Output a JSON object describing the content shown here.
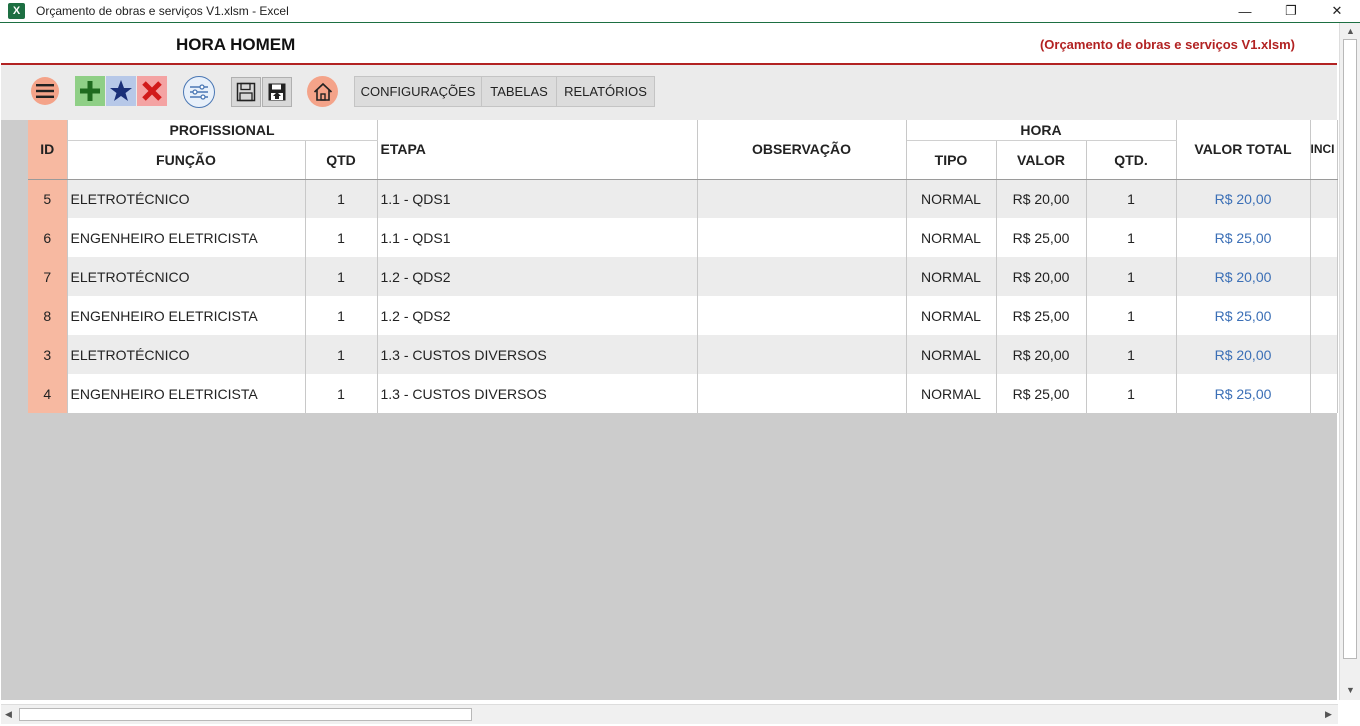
{
  "window": {
    "title": "Orçamento de obras e serviços V1.xlsm - Excel",
    "app_icon": "X",
    "minimize": "—",
    "restore": "❐",
    "close": "✕"
  },
  "header": {
    "page_title": "HORA HOMEM",
    "file_name": "(Orçamento de obras e serviços V1.xlsm)"
  },
  "toolbar": {
    "icons": [
      "menu-icon",
      "add-icon",
      "star-icon",
      "delete-icon",
      "filter-settings-icon",
      "save-icon",
      "save-as-icon",
      "home-icon"
    ],
    "menus": [
      "CONFIGURAÇÕES",
      "TABELAS",
      "RELATÓRIOS"
    ]
  },
  "table": {
    "group_headers": {
      "profissional": "PROFISSIONAL",
      "hora": "HORA"
    },
    "headers": {
      "id": "ID",
      "funcao": "FUNÇÃO",
      "qtd": "QTD",
      "etapa": "ETAPA",
      "observacao": "OBSERVAÇÃO",
      "tipo": "TIPO",
      "valor": "VALOR",
      "qtd_hora": "QTD.",
      "valor_total": "VALOR TOTAL",
      "clipped": "INCI"
    },
    "rows": [
      {
        "id": "5",
        "funcao": "ELETROTÉCNICO",
        "qtd": "1",
        "etapa": "1.1 - QDS1",
        "observacao": "",
        "tipo": "NORMAL",
        "valor": "R$ 20,00",
        "qtd_hora": "1",
        "valor_total": "R$ 20,00"
      },
      {
        "id": "6",
        "funcao": "ENGENHEIRO ELETRICISTA",
        "qtd": "1",
        "etapa": "1.1 - QDS1",
        "observacao": "",
        "tipo": "NORMAL",
        "valor": "R$ 25,00",
        "qtd_hora": "1",
        "valor_total": "R$ 25,00"
      },
      {
        "id": "7",
        "funcao": "ELETROTÉCNICO",
        "qtd": "1",
        "etapa": "1.2 - QDS2",
        "observacao": "",
        "tipo": "NORMAL",
        "valor": "R$ 20,00",
        "qtd_hora": "1",
        "valor_total": "R$ 20,00"
      },
      {
        "id": "8",
        "funcao": "ENGENHEIRO ELETRICISTA",
        "qtd": "1",
        "etapa": "1.2 - QDS2",
        "observacao": "",
        "tipo": "NORMAL",
        "valor": "R$ 25,00",
        "qtd_hora": "1",
        "valor_total": "R$ 25,00"
      },
      {
        "id": "3",
        "funcao": "ELETROTÉCNICO",
        "qtd": "1",
        "etapa": "1.3 - CUSTOS DIVERSOS",
        "observacao": "",
        "tipo": "NORMAL",
        "valor": "R$ 20,00",
        "qtd_hora": "1",
        "valor_total": "R$ 20,00"
      },
      {
        "id": "4",
        "funcao": "ENGENHEIRO ELETRICISTA",
        "qtd": "1",
        "etapa": "1.3 - CUSTOS DIVERSOS",
        "observacao": "",
        "tipo": "NORMAL",
        "valor": "R$ 25,00",
        "qtd_hora": "1",
        "valor_total": "R$ 25,00"
      }
    ]
  },
  "colors": {
    "accent_red": "#b22222",
    "id_column": "#f7b9a1",
    "excel_green": "#1d6f42",
    "value_blue": "#3b6fb6"
  }
}
